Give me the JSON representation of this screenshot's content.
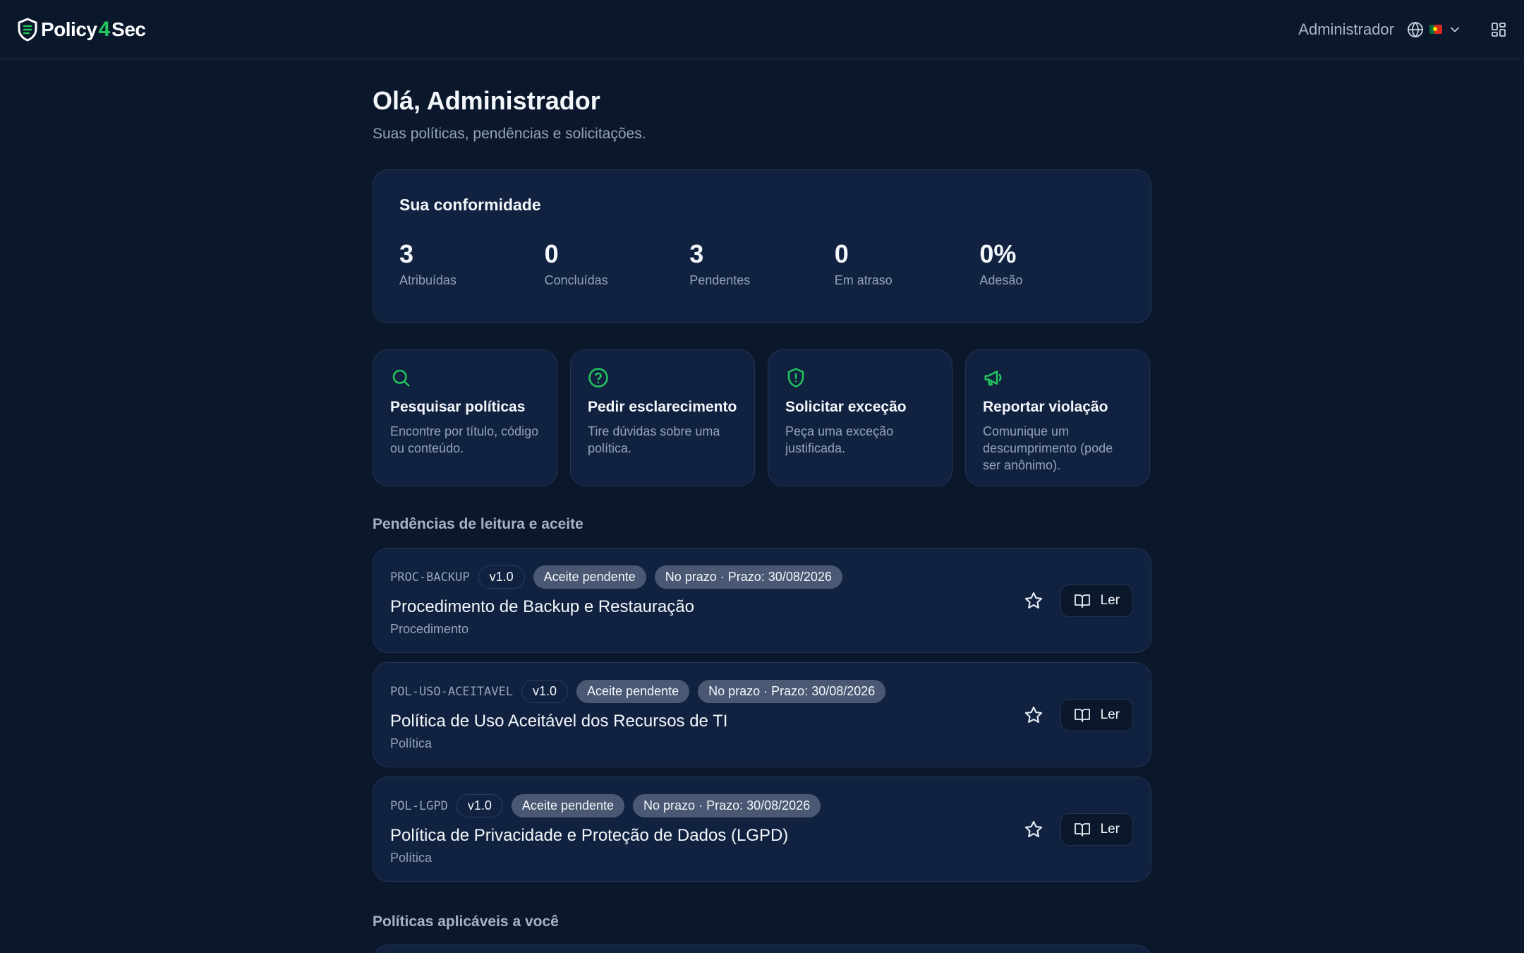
{
  "header": {
    "logo_part1": "Policy",
    "logo_bolt": "4",
    "logo_part2": "Sec",
    "user_name": "Administrador"
  },
  "main": {
    "greeting": "Olá, Administrador",
    "subtitle": "Suas políticas, pendências e solicitações."
  },
  "compliance": {
    "title": "Sua conformidade",
    "stats": [
      {
        "value": "3",
        "label": "Atribuídas"
      },
      {
        "value": "0",
        "label": "Concluídas"
      },
      {
        "value": "3",
        "label": "Pendentes"
      },
      {
        "value": "0",
        "label": "Em atraso"
      },
      {
        "value": "0%",
        "label": "Adesão"
      }
    ]
  },
  "actions": [
    {
      "icon": "search-icon",
      "title": "Pesquisar políticas",
      "desc": "Encontre por título, código ou conteúdo."
    },
    {
      "icon": "help-circle-icon",
      "title": "Pedir esclarecimento",
      "desc": "Tire dúvidas sobre uma política."
    },
    {
      "icon": "shield-alert-icon",
      "title": "Solicitar exceção",
      "desc": "Peça uma exceção justificada."
    },
    {
      "icon": "megaphone-icon",
      "title": "Reportar violação",
      "desc": "Comunique um descumprimento (pode ser anônimo)."
    }
  ],
  "pending": {
    "title": "Pendências de leitura e aceite",
    "read_label": "Ler",
    "items": [
      {
        "code": "PROC-BACKUP",
        "version": "v1.0",
        "status": "Aceite pendente",
        "deadline": "No prazo · Prazo: 30/08/2026",
        "title": "Procedimento de Backup e Restauração",
        "type": "Procedimento"
      },
      {
        "code": "POL-USO-ACEITAVEL",
        "version": "v1.0",
        "status": "Aceite pendente",
        "deadline": "No prazo · Prazo: 30/08/2026",
        "title": "Política de Uso Aceitável dos Recursos de TI",
        "type": "Política"
      },
      {
        "code": "POL-LGPD",
        "version": "v1.0",
        "status": "Aceite pendente",
        "deadline": "No prazo · Prazo: 30/08/2026",
        "title": "Política de Privacidade e Proteção de Dados (LGPD)",
        "type": "Política"
      }
    ]
  },
  "applicable": {
    "title": "Políticas aplicáveis a você"
  },
  "colors": {
    "background": "#0b172b",
    "card": "#112240",
    "accent": "#22c55e",
    "muted_text": "#94a3b8",
    "pill": "#4a5873"
  }
}
